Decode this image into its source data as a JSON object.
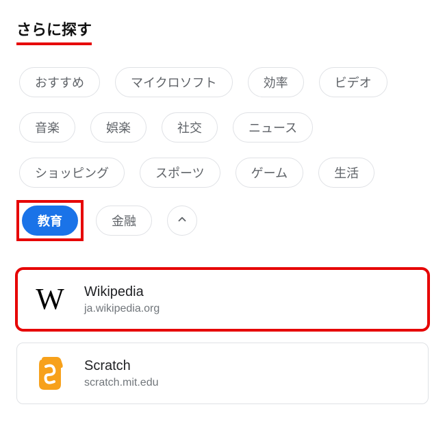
{
  "header": {
    "title": "さらに探す"
  },
  "chips": [
    {
      "id": "recommend",
      "label": "おすすめ",
      "active": false
    },
    {
      "id": "microsoft",
      "label": "マイクロソフト",
      "active": false
    },
    {
      "id": "efficiency",
      "label": "効率",
      "active": false
    },
    {
      "id": "video",
      "label": "ビデオ",
      "active": false
    },
    {
      "id": "music",
      "label": "音楽",
      "active": false
    },
    {
      "id": "entertainment",
      "label": "娯楽",
      "active": false
    },
    {
      "id": "social",
      "label": "社交",
      "active": false
    },
    {
      "id": "news",
      "label": "ニュース",
      "active": false
    },
    {
      "id": "shopping",
      "label": "ショッピング",
      "active": false
    },
    {
      "id": "sports",
      "label": "スポーツ",
      "active": false
    },
    {
      "id": "game",
      "label": "ゲーム",
      "active": false
    },
    {
      "id": "life",
      "label": "生活",
      "active": false
    },
    {
      "id": "education",
      "label": "教育",
      "active": true,
      "highlight": true
    },
    {
      "id": "finance",
      "label": "金融",
      "active": false
    }
  ],
  "results": [
    {
      "id": "wikipedia",
      "title": "Wikipedia",
      "subtitle": "ja.wikipedia.org",
      "icon": "wikipedia-icon",
      "highlight": true
    },
    {
      "id": "scratch",
      "title": "Scratch",
      "subtitle": "scratch.mit.edu",
      "icon": "scratch-icon",
      "highlight": false
    }
  ],
  "icons": {
    "wikipedia_glyph": "W"
  }
}
